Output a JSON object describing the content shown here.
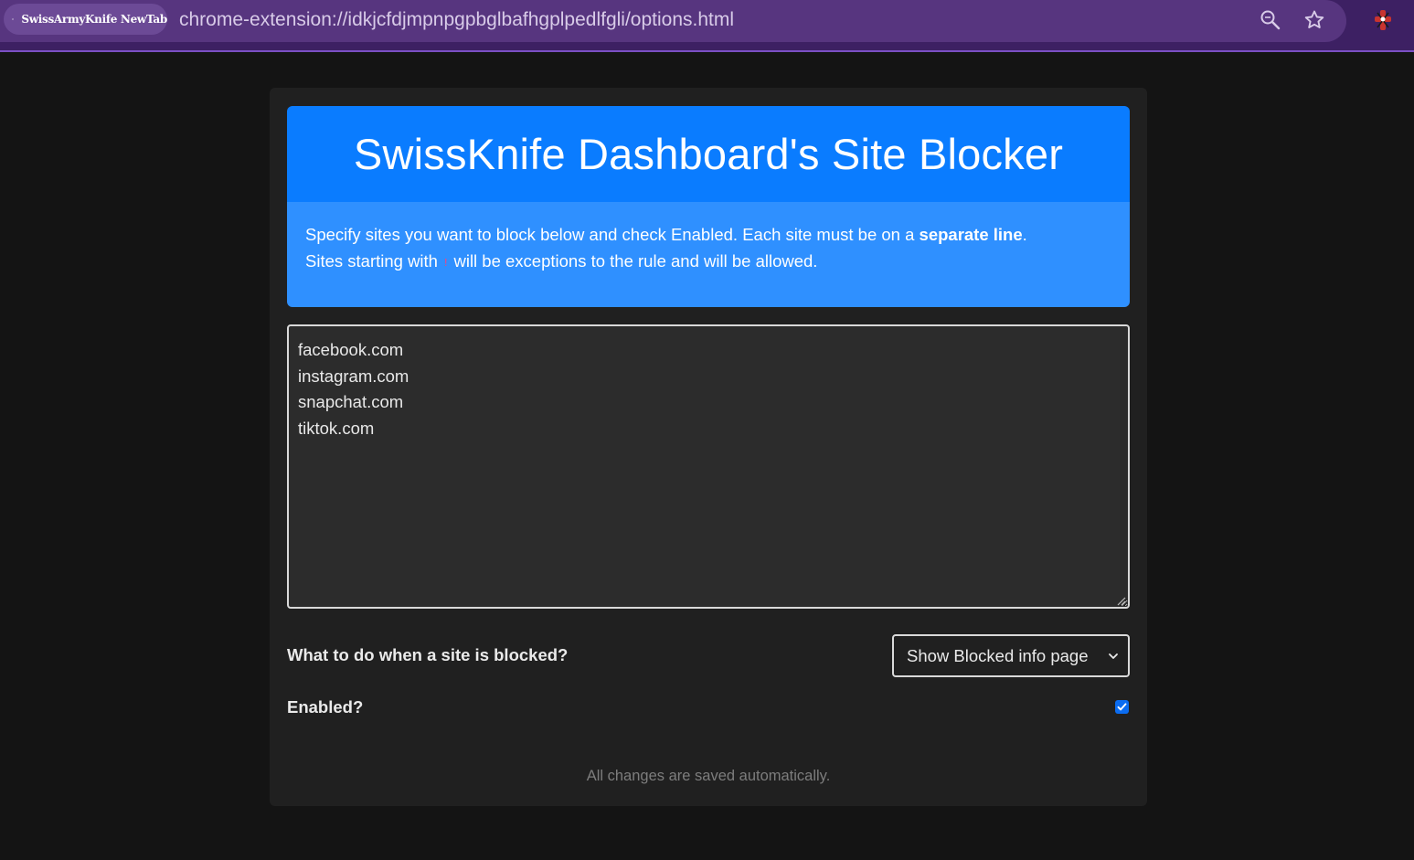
{
  "browser": {
    "extension_chip_label": "SwissArmyKnife NewTab",
    "url": "chrome-extension://idkjcfdjmpnpgpbglbafhgplpedlfgli/options.html",
    "icons": [
      "puzzle-icon",
      "zoom-icon",
      "star-icon",
      "extension-icon"
    ],
    "accent_color": "#7b4fc4"
  },
  "page": {
    "title": "SwissKnife Dashboard's Site Blocker",
    "info": {
      "line1_prefix": "Specify sites you want to block below and check Enabled. Each site must be on a ",
      "line1_bold": "separate line",
      "line1_suffix": ".",
      "line2_prefix": "Sites starting with ",
      "line2_code": "!",
      "line2_suffix": " will be exceptions to the rule and will be allowed."
    },
    "sites_text": "facebook.com\ninstagram.com\nsnapchat.com\ntiktok.com",
    "blocked_action_label": "What to do when a site is blocked?",
    "blocked_action_value": "Show Blocked info page",
    "enabled_label": "Enabled?",
    "enabled": true,
    "footer_note": "All changes are saved automatically.",
    "header_color": "#0a7cff",
    "info_color": "#2f90ff"
  }
}
